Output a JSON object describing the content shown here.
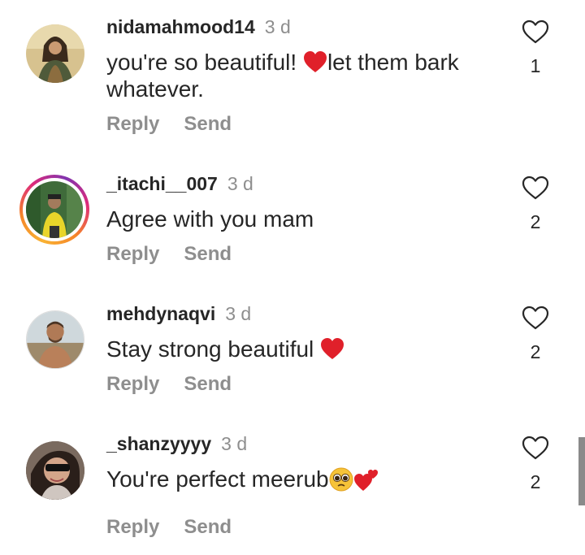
{
  "comments": [
    {
      "username": "nidamahmood14",
      "time": "3 d",
      "text_before": "you're so beautiful! ",
      "text_after": "let them bark whatever.",
      "reply_label": "Reply",
      "send_label": "Send",
      "likes": "1"
    },
    {
      "username": "_itachi__007",
      "time": "3 d",
      "text": "Agree with you mam",
      "reply_label": "Reply",
      "send_label": "Send",
      "likes": "2"
    },
    {
      "username": "mehdynaqvi",
      "time": "3 d",
      "text": "Stay strong beautiful ",
      "reply_label": "Reply",
      "send_label": "Send",
      "likes": "2"
    },
    {
      "username": "_shanzyyyy",
      "time": "3 d",
      "text": "You're perfect meerub",
      "reply_label": "Reply",
      "send_label": "Send",
      "likes": "2"
    }
  ],
  "icons": {
    "like": "heart-outline-icon",
    "emoji_heart": "red-heart-emoji",
    "emoji_pleading": "pleading-face-emoji",
    "emoji_two_hearts": "two-hearts-emoji"
  },
  "colors": {
    "text": "#262626",
    "muted": "#8e8e8e",
    "heart_red": "#e0202a"
  }
}
